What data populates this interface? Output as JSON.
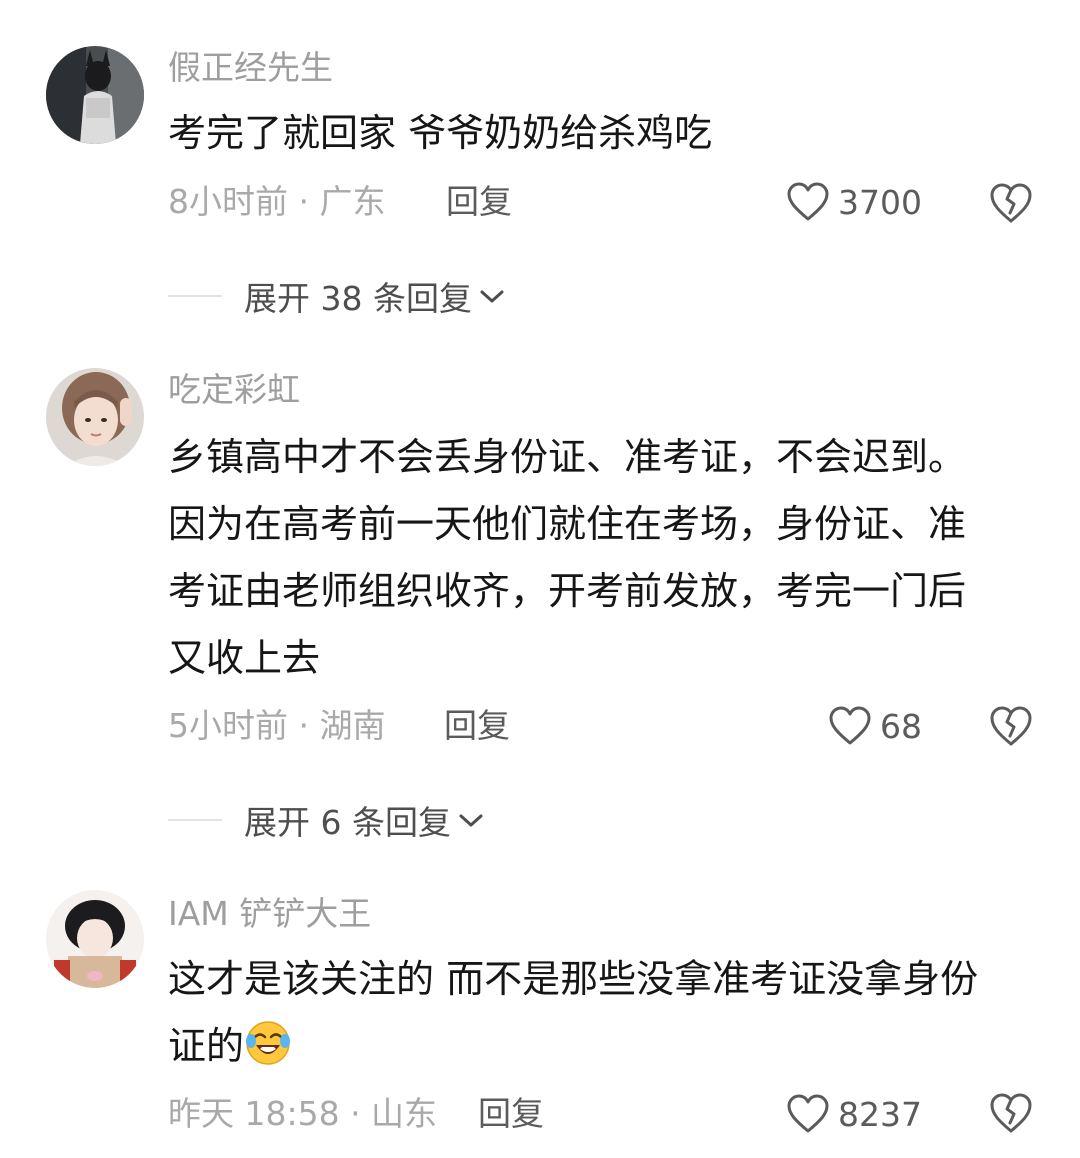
{
  "comments": [
    {
      "username": "假正经先生",
      "text": "考完了就回家 爷爷奶奶给杀鸡吃",
      "time_location": "8小时前 · 广东",
      "reply_label": "回复",
      "likes": "3700",
      "expand_label": "展开 38 条回复"
    },
    {
      "username": "吃定彩虹",
      "text_lines": [
        "乡镇高中才不会丢身份证、准考证，不会迟到。",
        "因为在高考前一天他们就住在考场，身份证、准",
        "考证由老师组织收齐，开考前发放，考完一门后",
        "又收上去"
      ],
      "time_location": "5小时前 · 湖南",
      "reply_label": "回复",
      "likes": "68",
      "expand_label": "展开 6 条回复"
    },
    {
      "username": "IAM 铲铲大王",
      "text_lines": [
        "这才是该关注的 而不是那些没拿准考证没拿身份",
        "证的"
      ],
      "emoji": "laughing-crying-emoji",
      "time_location": "昨天 18:58 · 山东",
      "reply_label": "回复",
      "likes": "8237"
    }
  ],
  "colors": {
    "username": "#9e9e9e",
    "body_text": "#161616",
    "meta": "#a9a9a9",
    "action": "#5b5b5b",
    "background": "#ffffff"
  },
  "icons": [
    "heart-outline-icon",
    "broken-heart-icon",
    "chevron-down-icon"
  ]
}
